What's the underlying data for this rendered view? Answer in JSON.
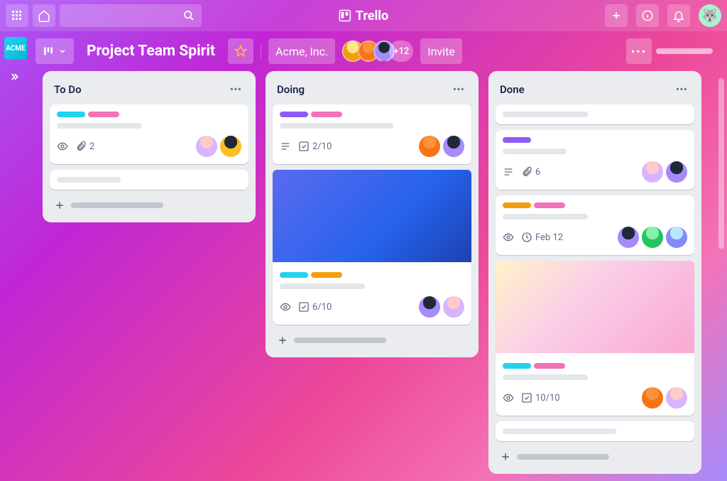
{
  "brand": "Trello",
  "workspace_badge": "ACME",
  "board": {
    "title": "Project Team Spirit",
    "org": "Acme, Inc.",
    "extra_members": "+12",
    "invite_label": "Invite"
  },
  "colors": {
    "label_teal": "#22d3ee",
    "label_pink": "#f472b6",
    "label_purple": "#8b5cf6",
    "label_yellow": "#f59e0b"
  },
  "lists": [
    {
      "title": "To Do",
      "cards": [
        {
          "labels": [
            "teal",
            "pink"
          ],
          "badges": {
            "watch": true,
            "attach": "2"
          },
          "members": [
            "a",
            "b"
          ]
        },
        {
          "labels": [],
          "text_only": true
        }
      ]
    },
    {
      "title": "Doing",
      "cards": [
        {
          "labels": [
            "purple",
            "pink"
          ],
          "badges": {
            "desc": true,
            "check": "2/10"
          },
          "members": [
            "c",
            "d"
          ]
        },
        {
          "cover": "blue",
          "labels": [
            "teal",
            "yellow"
          ],
          "badges": {
            "watch": true,
            "check": "6/10"
          },
          "members": [
            "d",
            "e"
          ]
        }
      ]
    },
    {
      "title": "Done",
      "cards": [
        {
          "labels": [],
          "text_only": true
        },
        {
          "labels": [
            "purple"
          ],
          "badges": {
            "desc": true,
            "attach": "6"
          },
          "members": [
            "e",
            "d"
          ]
        },
        {
          "labels": [
            "yellow",
            "pink"
          ],
          "badges": {
            "watch": true,
            "date": "Feb 12"
          },
          "members": [
            "d",
            "f",
            "g"
          ]
        },
        {
          "cover": "pink",
          "labels": [
            "teal",
            "pink"
          ],
          "badges": {
            "watch": true,
            "check": "10/10"
          },
          "members": [
            "c",
            "e"
          ]
        },
        {
          "labels": [],
          "text_only": true
        }
      ]
    }
  ]
}
